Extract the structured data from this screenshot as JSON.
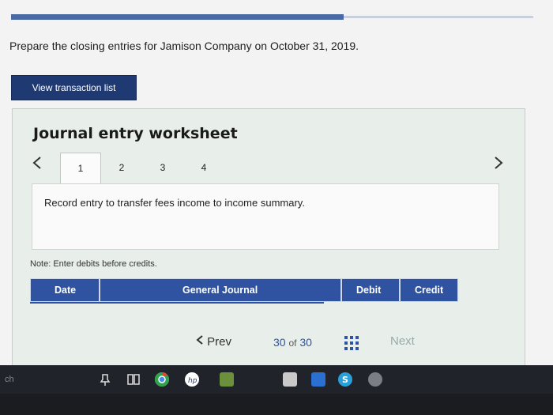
{
  "instructions": "Prepare the closing entries for Jamison Company on October 31, 2019.",
  "view_button": "View transaction list",
  "worksheet": {
    "title": "Journal entry worksheet",
    "nav_prev": "<",
    "nav_next": ">",
    "tabs": [
      "1",
      "2",
      "3",
      "4"
    ],
    "entry_text": "Record entry to transfer fees income to income summary.",
    "note": "Note: Enter debits before credits.",
    "columns": {
      "date": "Date",
      "journal": "General Journal",
      "debit": "Debit",
      "credit": "Credit"
    }
  },
  "pager": {
    "prev": "Prev",
    "current": "30",
    "of": "of",
    "total": "30",
    "next": "Next"
  },
  "taskbar": {
    "label": "ch",
    "icons": [
      "pin-icon",
      "task-view-icon",
      "chrome-icon",
      "hp-icon",
      "app-icon",
      "store-icon",
      "windows-icon",
      "skype-icon",
      "app2-icon"
    ]
  },
  "colors": {
    "accent": "#2f53a0",
    "button": "#1f3a73"
  }
}
